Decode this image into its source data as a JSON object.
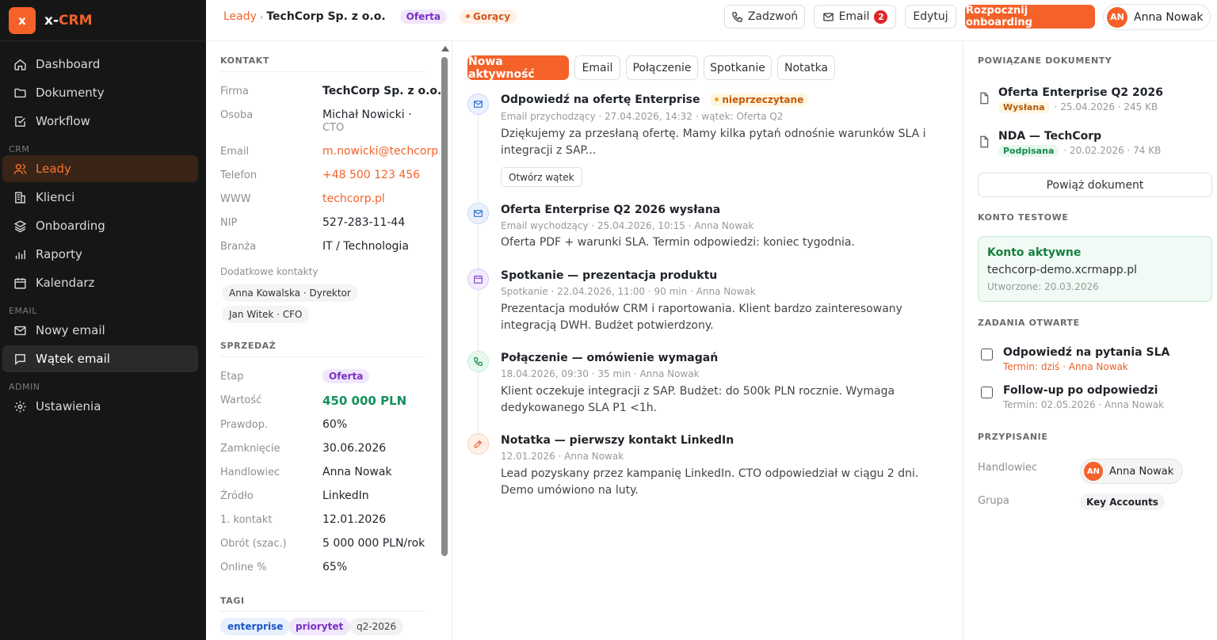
{
  "brand": {
    "logo_letter": "x",
    "name_prefix": "x-",
    "name_suffix": "CRM"
  },
  "sidebar": {
    "items": [
      {
        "label": "Dashboard",
        "icon": "home-icon"
      },
      {
        "label": "Dokumenty",
        "icon": "folder-icon"
      },
      {
        "label": "Workflow",
        "icon": "check-square-icon"
      }
    ],
    "crm_label": "CRM",
    "crm_items": [
      {
        "label": "Leady",
        "icon": "users-icon",
        "active": true
      },
      {
        "label": "Klienci",
        "icon": "building-icon"
      },
      {
        "label": "Onboarding",
        "icon": "layers-icon"
      },
      {
        "label": "Raporty",
        "icon": "bar-chart-icon"
      },
      {
        "label": "Kalendarz",
        "icon": "calendar-icon"
      }
    ],
    "email_label": "EMAIL",
    "email_items": [
      {
        "label": "Nowy email",
        "icon": "mail-icon"
      },
      {
        "label": "Wątek email",
        "icon": "message-icon",
        "highlighted": true
      }
    ],
    "admin_label": "ADMIN",
    "admin_items": [
      {
        "label": "Ustawienia",
        "icon": "gear-icon"
      }
    ]
  },
  "topbar": {
    "breadcrumb_parent": "Leady",
    "breadcrumb_sep": "›",
    "breadcrumb_current": "TechCorp Sp. z o.o.",
    "stage_badge": "Oferta",
    "heat_badge": "Gorący",
    "call_label": "Zadzwoń",
    "email_label": "Email",
    "email_count": "2",
    "edit_label": "Edytuj",
    "onboarding_label": "Rozpocznij onboarding",
    "user_initials": "AN",
    "user_name": "Anna Nowak"
  },
  "contact": {
    "title": "KONTAKT",
    "firma_k": "Firma",
    "firma_v": "TechCorp Sp. z o.o.",
    "osoba_k": "Osoba",
    "osoba_v": "Michał Nowicki ·",
    "osoba_role": "CTO",
    "email_k": "Email",
    "email_v": "m.nowicki@techcorp.pl",
    "tel_k": "Telefon",
    "tel_v": "+48 500 123 456",
    "www_k": "WWW",
    "www_v": "techcorp.pl",
    "nip_k": "NIP",
    "nip_v": "527-283-11-44",
    "branza_k": "Branża",
    "branza_v": "IT / Technologia",
    "extra_label": "Dodatkowe kontakty",
    "extra_contacts": [
      "Anna Kowalska · Dyrektor",
      "Jan Witek · CFO"
    ]
  },
  "sales": {
    "title": "SPRZEDAŻ",
    "etap_k": "Etap",
    "etap_v": "Oferta",
    "wartosc_k": "Wartość",
    "wartosc_v": "450 000 PLN",
    "prawd_k": "Prawdop.",
    "prawd_v": "60%",
    "zamk_k": "Zamknięcie",
    "zamk_v": "30.06.2026",
    "handl_k": "Handlowiec",
    "handl_v": "Anna Nowak",
    "zrodlo_k": "Źródło",
    "zrodlo_v": "LinkedIn",
    "kontakt_k": "1. kontakt",
    "kontakt_v": "12.01.2026",
    "obrot_k": "Obrót (szac.)",
    "obrot_v": "5 000 000 PLN/rok",
    "online_k": "Online %",
    "online_v": "65%"
  },
  "tags": {
    "title": "TAGI",
    "items": [
      "enterprise",
      "priorytet",
      "q2-2026"
    ]
  },
  "activity": {
    "tabs": [
      "Nowa aktywność",
      "Email",
      "Połączenie",
      "Spotkanie",
      "Notatka"
    ],
    "events": [
      {
        "title": "Odpowiedź na ofertę Enterprise",
        "unread": "nieprzeczytane",
        "meta": "Email przychodzący · 27.04.2026, 14:32 · wątek: Oferta Q2",
        "body": "Dziękujemy za przesłaną ofertę. Mamy kilka pytań odnośnie warunków SLA i integracji z SAP...",
        "button": "Otwórz wątek",
        "icon": "mail-icon"
      },
      {
        "title": "Oferta Enterprise Q2 2026 wysłana",
        "meta": "Email wychodzący · 25.04.2026, 10:15 · Anna Nowak",
        "body": "Oferta PDF + warunki SLA. Termin odpowiedzi: koniec tygodnia.",
        "icon": "mail-icon"
      },
      {
        "title": "Spotkanie — prezentacja produktu",
        "meta": "Spotkanie · 22.04.2026, 11:00 · 90 min · Anna Nowak",
        "body": "Prezentacja modułów CRM i raportowania. Klient bardzo zainteresowany integracją DWH. Budżet potwierdzony.",
        "icon": "calendar-icon"
      },
      {
        "title": "Połączenie — omówienie wymagań",
        "meta": "18.04.2026, 09:30 · 35 min · Anna Nowak",
        "body": "Klient oczekuje integracji z SAP. Budżet: do 500k PLN rocznie. Wymaga dedykowanego SLA P1 <1h.",
        "icon": "phone-icon"
      },
      {
        "title": "Notatka — pierwszy kontakt LinkedIn",
        "meta": "12.01.2026 · Anna Nowak",
        "body": "Lead pozyskany przez kampanię LinkedIn. CTO odpowiedział w ciągu 2 dni. Demo umówiono na luty.",
        "icon": "edit-icon"
      }
    ]
  },
  "documents": {
    "title": "POWIĄZANE DOKUMENTY",
    "items": [
      {
        "name": "Oferta Enterprise Q2 2026",
        "status": "Wysłana",
        "meta": "· 25.04.2026 · 245 KB"
      },
      {
        "name": "NDA — TechCorp",
        "status": "Podpisana",
        "meta": "· 20.02.2026 · 74 KB"
      }
    ],
    "link_button": "Powiąż dokument"
  },
  "test_account": {
    "title": "KONTO TESTOWE",
    "status": "Konto aktywne",
    "domain": "techcorp-demo.xcrmapp.pl",
    "created": "Utworzone: 20.03.2026"
  },
  "tasks": {
    "title": "ZADANIA OTWARTE",
    "items": [
      {
        "title": "Odpowiedź na pytania SLA",
        "meta": "Termin: dziś · Anna Nowak",
        "due": true
      },
      {
        "title": "Follow-up po odpowiedzi",
        "meta": "Termin: 02.05.2026 · Anna Nowak",
        "due": false
      }
    ]
  },
  "assignment": {
    "title": "PRZYPISANIE",
    "handl_k": "Handlowiec",
    "handl_initials": "AN",
    "handl_v": "Anna Nowak",
    "grupa_k": "Grupa",
    "grupa_v": "Key Accounts"
  },
  "colors": {
    "accent": "#f4622a",
    "sidebar_bg": "#161616",
    "green": "#14915d"
  }
}
